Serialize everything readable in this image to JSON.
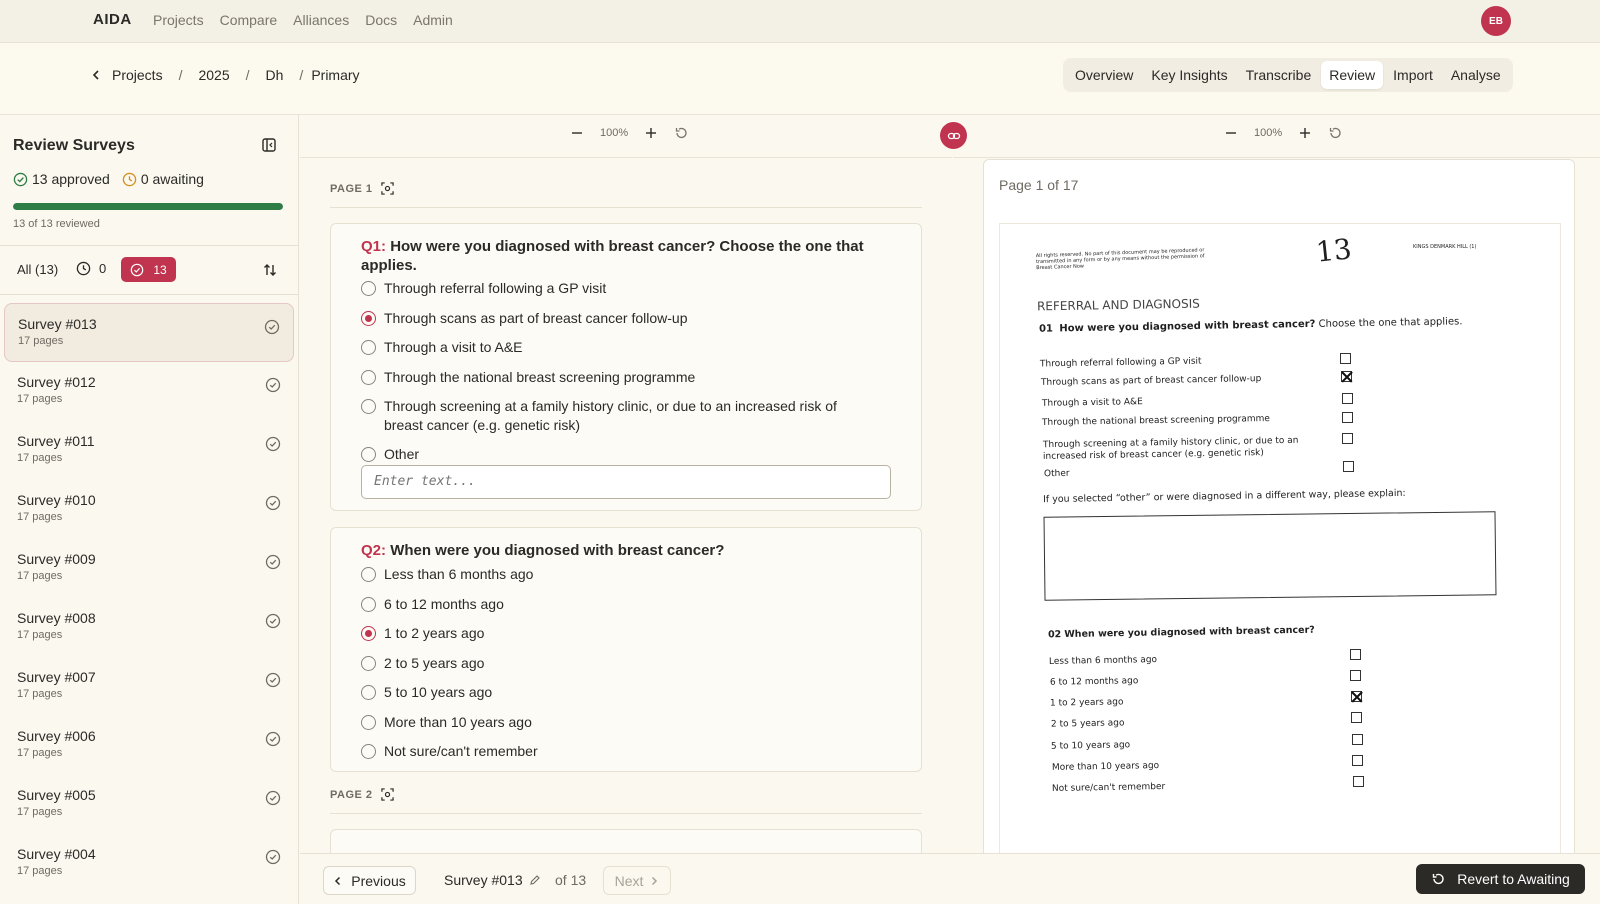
{
  "app": {
    "brand": "AIDA",
    "nav": [
      "Projects",
      "Compare",
      "Alliances",
      "Docs",
      "Admin"
    ],
    "avatar_initials": "EB"
  },
  "breadcrumb": [
    "Projects",
    "2025",
    "Dh",
    "Primary"
  ],
  "tabs": [
    "Overview",
    "Key Insights",
    "Transcribe",
    "Review",
    "Import",
    "Analyse"
  ],
  "active_tab": "Review",
  "sidebar": {
    "title": "Review Surveys",
    "approved": "13 approved",
    "awaiting": "0 awaiting",
    "progress_fraction": 1.0,
    "reviewed_text": "13 of 13 reviewed",
    "filter_all": "All (13)",
    "filter_clock_count": "0",
    "filter_approved_count": "13",
    "surveys": [
      {
        "name": "Survey #013",
        "pages": "17 pages"
      },
      {
        "name": "Survey #012",
        "pages": "17 pages"
      },
      {
        "name": "Survey #011",
        "pages": "17 pages"
      },
      {
        "name": "Survey #010",
        "pages": "17 pages"
      },
      {
        "name": "Survey #009",
        "pages": "17 pages"
      },
      {
        "name": "Survey #008",
        "pages": "17 pages"
      },
      {
        "name": "Survey #007",
        "pages": "17 pages"
      },
      {
        "name": "Survey #006",
        "pages": "17 pages"
      },
      {
        "name": "Survey #005",
        "pages": "17 pages"
      },
      {
        "name": "Survey #004",
        "pages": "17 pages"
      }
    ]
  },
  "zoom": {
    "left": "100%",
    "right": "100%"
  },
  "form": {
    "page1_label": "PAGE 1",
    "page2_label": "PAGE 2",
    "q1": {
      "num": "Q1:",
      "title": "How were you diagnosed with breast cancer? Choose the one that applies.",
      "options": [
        "Through referral following a GP visit",
        "Through scans as part of breast cancer follow-up",
        "Through a visit to A&E",
        "Through the national breast screening programme",
        "Through screening at a family history clinic, or due to an increased risk of breast cancer (e.g. genetic risk)",
        "Other"
      ],
      "selected_index": 1,
      "other_placeholder": "Enter text..."
    },
    "q2": {
      "num": "Q2:",
      "title": "When were you diagnosed with breast cancer?",
      "options": [
        "Less than 6 months ago",
        "6 to 12 months ago",
        "1 to 2 years ago",
        "2 to 5 years ago",
        "5 to 10 years ago",
        "More than 10 years ago",
        "Not sure/can't remember"
      ],
      "selected_index": 2
    }
  },
  "document": {
    "page_of": "Page 1 of 17",
    "scan": {
      "copyright": "All rights reserved. No part of this document may be reproduced or transmitted in any form or by any means without the permission of Breast Cancer Now",
      "handwritten_number": "13",
      "site": "KINGS DENMARK HILL (1)",
      "section": "REFERRAL AND DIAGNOSIS",
      "q1_num": "01",
      "q1_bold": "How were you diagnosed with breast cancer?",
      "q1_rest": "Choose the one that applies.",
      "q1_options": [
        "Through referral following a GP visit",
        "Through scans as part of breast cancer follow-up",
        "Through a visit to A&E",
        "Through the national breast screening programme",
        "Through screening at a family history clinic, or due to an",
        "increased risk of breast cancer (e.g. genetic risk)",
        "Other"
      ],
      "explain": "If you selected “other” or were diagnosed in a different way, please explain:",
      "q2_num": "02",
      "q2_title": "When were you diagnosed with breast cancer?",
      "q2_options": [
        "Less than 6 months ago",
        "6 to 12 months ago",
        "1 to 2 years ago",
        "2 to 5 years ago",
        "5 to 10 years ago",
        "More than 10 years ago",
        "Not sure/can't remember"
      ]
    }
  },
  "bottom": {
    "previous": "Previous",
    "current": "Survey #013",
    "of": "of 13",
    "next": "Next",
    "revert": "Revert to Awaiting"
  },
  "colors": {
    "accent": "#c0344f",
    "progress": "#2e7d46",
    "dark_button": "#2b2a27"
  }
}
